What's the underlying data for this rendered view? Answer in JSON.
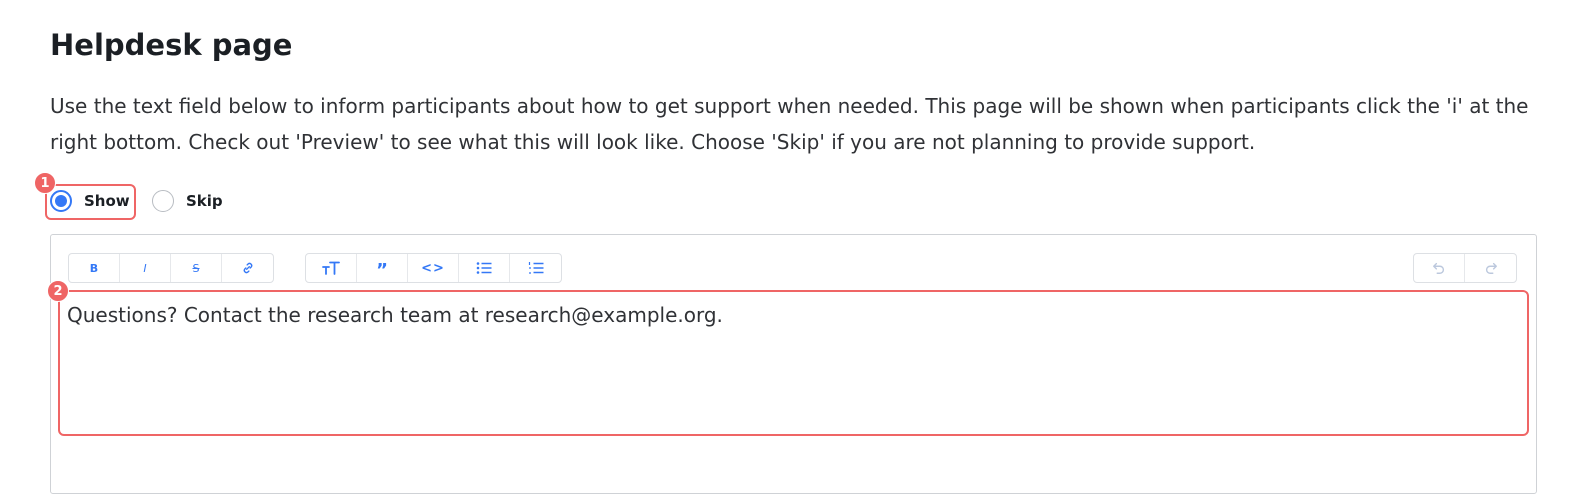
{
  "page": {
    "title": "Helpdesk page",
    "description": "Use the text field below to inform participants about how to get support when needed. This page will be shown when participants click the 'i' at the right bottom. Check out 'Preview' to see what this will look like. Choose 'Skip' if you are not planning to provide support."
  },
  "options": {
    "show_label": "Show",
    "skip_label": "Skip",
    "selected": "Show"
  },
  "annotations": {
    "badge_1": "1",
    "badge_2": "2"
  },
  "toolbar": {
    "bold": "B",
    "italic": "I",
    "strike": "S",
    "quote": "”",
    "code": "<>"
  },
  "editor": {
    "content": "Questions? Contact the research team at research@example.org."
  },
  "colors": {
    "accent": "#3478f6",
    "highlight": "#ef6565"
  }
}
